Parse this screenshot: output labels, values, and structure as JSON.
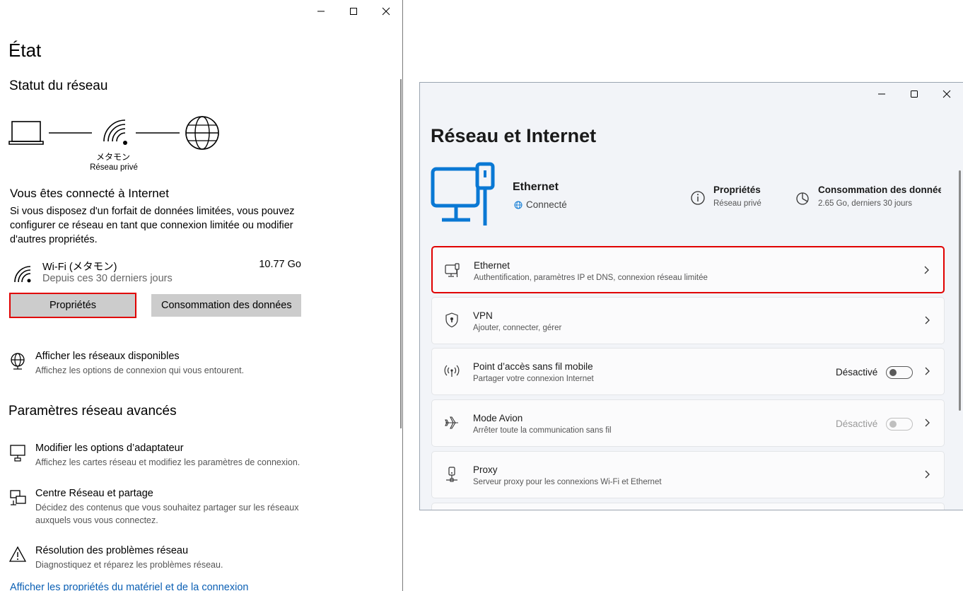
{
  "left_window": {
    "page_title": "État",
    "network_status_heading": "Statut du réseau",
    "network_name": "メタモン",
    "network_type": "Réseau privé",
    "connected_heading": "Vous êtes connecté à Internet",
    "connected_desc": "Si vous disposez d'un forfait de données limitées, vous pouvez configurer ce réseau en tant que connexion limitée ou modifier d'autres propriétés.",
    "wifi_name": "Wi-Fi (メタモン)",
    "wifi_period": "Depuis ces 30 derniers jours",
    "wifi_usage": "10.77 Go",
    "properties_button": "Propriétés",
    "data_usage_button": "Consommation des données",
    "show_networks_title": "Afficher les réseaux disponibles",
    "show_networks_desc": "Affichez les options de connexion qui vous entourent.",
    "advanced_heading": "Paramètres réseau avancés",
    "adapter_title": "Modifier les options d’adaptateur",
    "adapter_desc": "Affichez les cartes réseau et modifiez les paramètres de connexion.",
    "sharing_title": "Centre Réseau et partage",
    "sharing_desc": "Décidez des contenus que vous souhaitez partager sur les réseaux auxquels vous vous connectez.",
    "troubleshoot_title": "Résolution des problèmes réseau",
    "troubleshoot_desc": "Diagnostiquez et réparez les problèmes réseau.",
    "hardware_link": "Afficher les propriétés du matériel et de la connexion"
  },
  "right_window": {
    "page_title": "Réseau et Internet",
    "connection_name": "Ethernet",
    "connection_status": "Connecté",
    "properties_label": "Propriétés",
    "properties_sub": "Réseau privé",
    "data_usage_label": "Consommation des données",
    "data_usage_sub": "2.65 Go, derniers 30 jours",
    "items": [
      {
        "title": "Ethernet",
        "desc": "Authentification, paramètres IP et DNS, connexion réseau limitée"
      },
      {
        "title": "VPN",
        "desc": "Ajouter, connecter, gérer"
      },
      {
        "title": "Point d’accès sans fil mobile",
        "desc": "Partager votre connexion Internet",
        "state": "Désactivé"
      },
      {
        "title": "Mode Avion",
        "desc": "Arrêter toute la communication sans fil",
        "state": "Désactivé"
      },
      {
        "title": "Proxy",
        "desc": "Serveur proxy pour les connexions Wi-Fi et Ethernet"
      }
    ]
  },
  "colors": {
    "highlight": "#e00000",
    "accent": "#0a78d4",
    "button_gray": "#cccccc"
  }
}
